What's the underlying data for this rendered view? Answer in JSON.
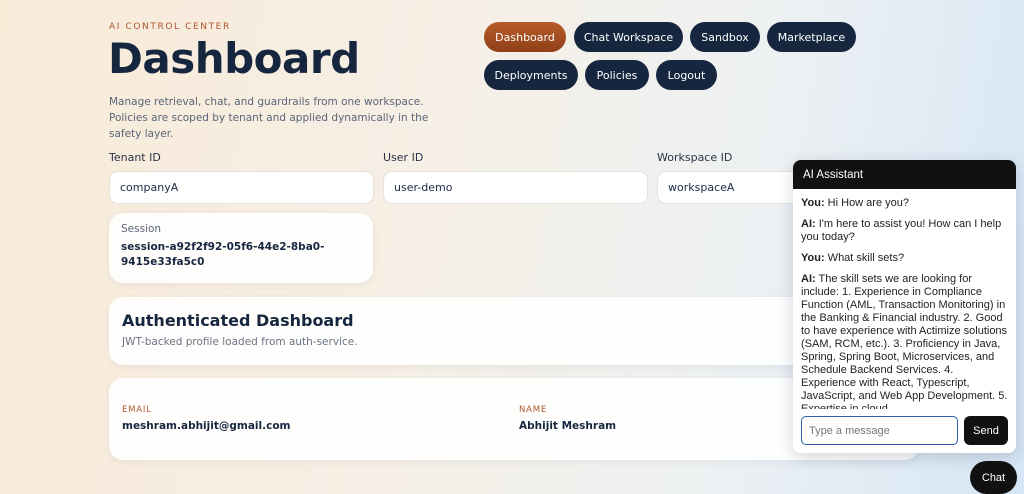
{
  "header": {
    "eyebrow": "AI CONTROL CENTER",
    "title": "Dashboard",
    "subtitle": "Manage retrieval, chat, and guardrails from one workspace. Policies are scoped by tenant and applied dynamically in the safety layer."
  },
  "nav": {
    "items": [
      {
        "label": "Dashboard",
        "active": true
      },
      {
        "label": "Chat Workspace"
      },
      {
        "label": "Sandbox"
      },
      {
        "label": "Marketplace"
      },
      {
        "label": "Deployments"
      },
      {
        "label": "Policies"
      },
      {
        "label": "Logout"
      }
    ]
  },
  "fields": {
    "tenant": {
      "label": "Tenant ID",
      "value": "companyA"
    },
    "user": {
      "label": "User ID",
      "value": "user-demo"
    },
    "workspace": {
      "label": "Workspace ID",
      "value": "workspaceA"
    }
  },
  "session": {
    "label": "Session",
    "value": "session-a92f2f92-05f6-44e2-8ba0-9415e33fa5c0"
  },
  "auth": {
    "title": "Authenticated Dashboard",
    "subtitle": "JWT-backed profile loaded from auth-service."
  },
  "profile": {
    "email_label": "EMAIL",
    "email_value": "meshram.abhijit@gmail.com",
    "name_label": "NAME",
    "name_value": "Abhijit Meshram"
  },
  "chat": {
    "title": "AI Assistant",
    "messages": [
      {
        "who": "You:",
        "text": " Hi How are you?"
      },
      {
        "who": "AI:",
        "text": " I'm here to assist you! How can I help you today?"
      },
      {
        "who": "You:",
        "text": " What skill sets?"
      },
      {
        "who": "AI:",
        "text": " The skill sets we are looking for include: 1. Experience in Compliance Function (AML, Transaction Monitoring) in the Banking & Financial industry. 2. Good to have experience with Actimize solutions (SAM, RCM, etc.). 3. Proficiency in Java, Spring, Spring Boot, Microservices, and Schedule Backend Services. 4. Experience with React, Typescript, JavaScript, and Web App Development. 5. Expertise in cloud"
      }
    ],
    "input_placeholder": "Type a message",
    "send_label": "Send",
    "fab_label": "Chat"
  }
}
